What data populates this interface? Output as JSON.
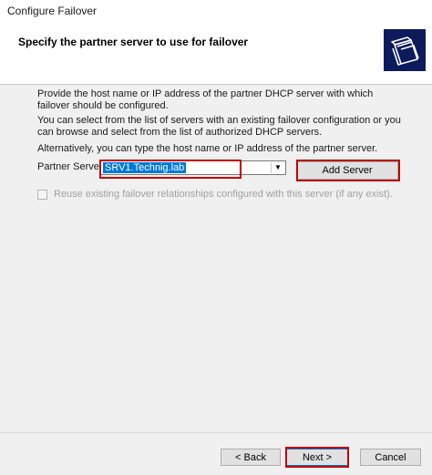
{
  "window": {
    "title": "Configure Failover"
  },
  "header": {
    "title": "Specify the partner server to use for failover",
    "icon": "wizard-icon"
  },
  "main": {
    "para1": "Provide the host name or IP address of the partner DHCP server with which failover should be configured.",
    "para2": "You can select from the list of servers with an existing failover configuration or you can browse and select from the list of authorized DHCP servers.",
    "para3": "Alternatively, you can type the host name or IP address of the partner server.",
    "partner_label": "Partner Server:",
    "partner_value": "SRV1.Technig.lab",
    "add_server_label": "Add Server",
    "reuse_label": "Reuse existing failover relationships configured with this server (if any exist).",
    "reuse_checked": false
  },
  "footer": {
    "back_label": "< Back",
    "next_label": "Next >",
    "cancel_label": "Cancel"
  },
  "colors": {
    "highlight": "#c00000",
    "selection": "#0078d7",
    "icon_bg": "#0d1a5c"
  }
}
